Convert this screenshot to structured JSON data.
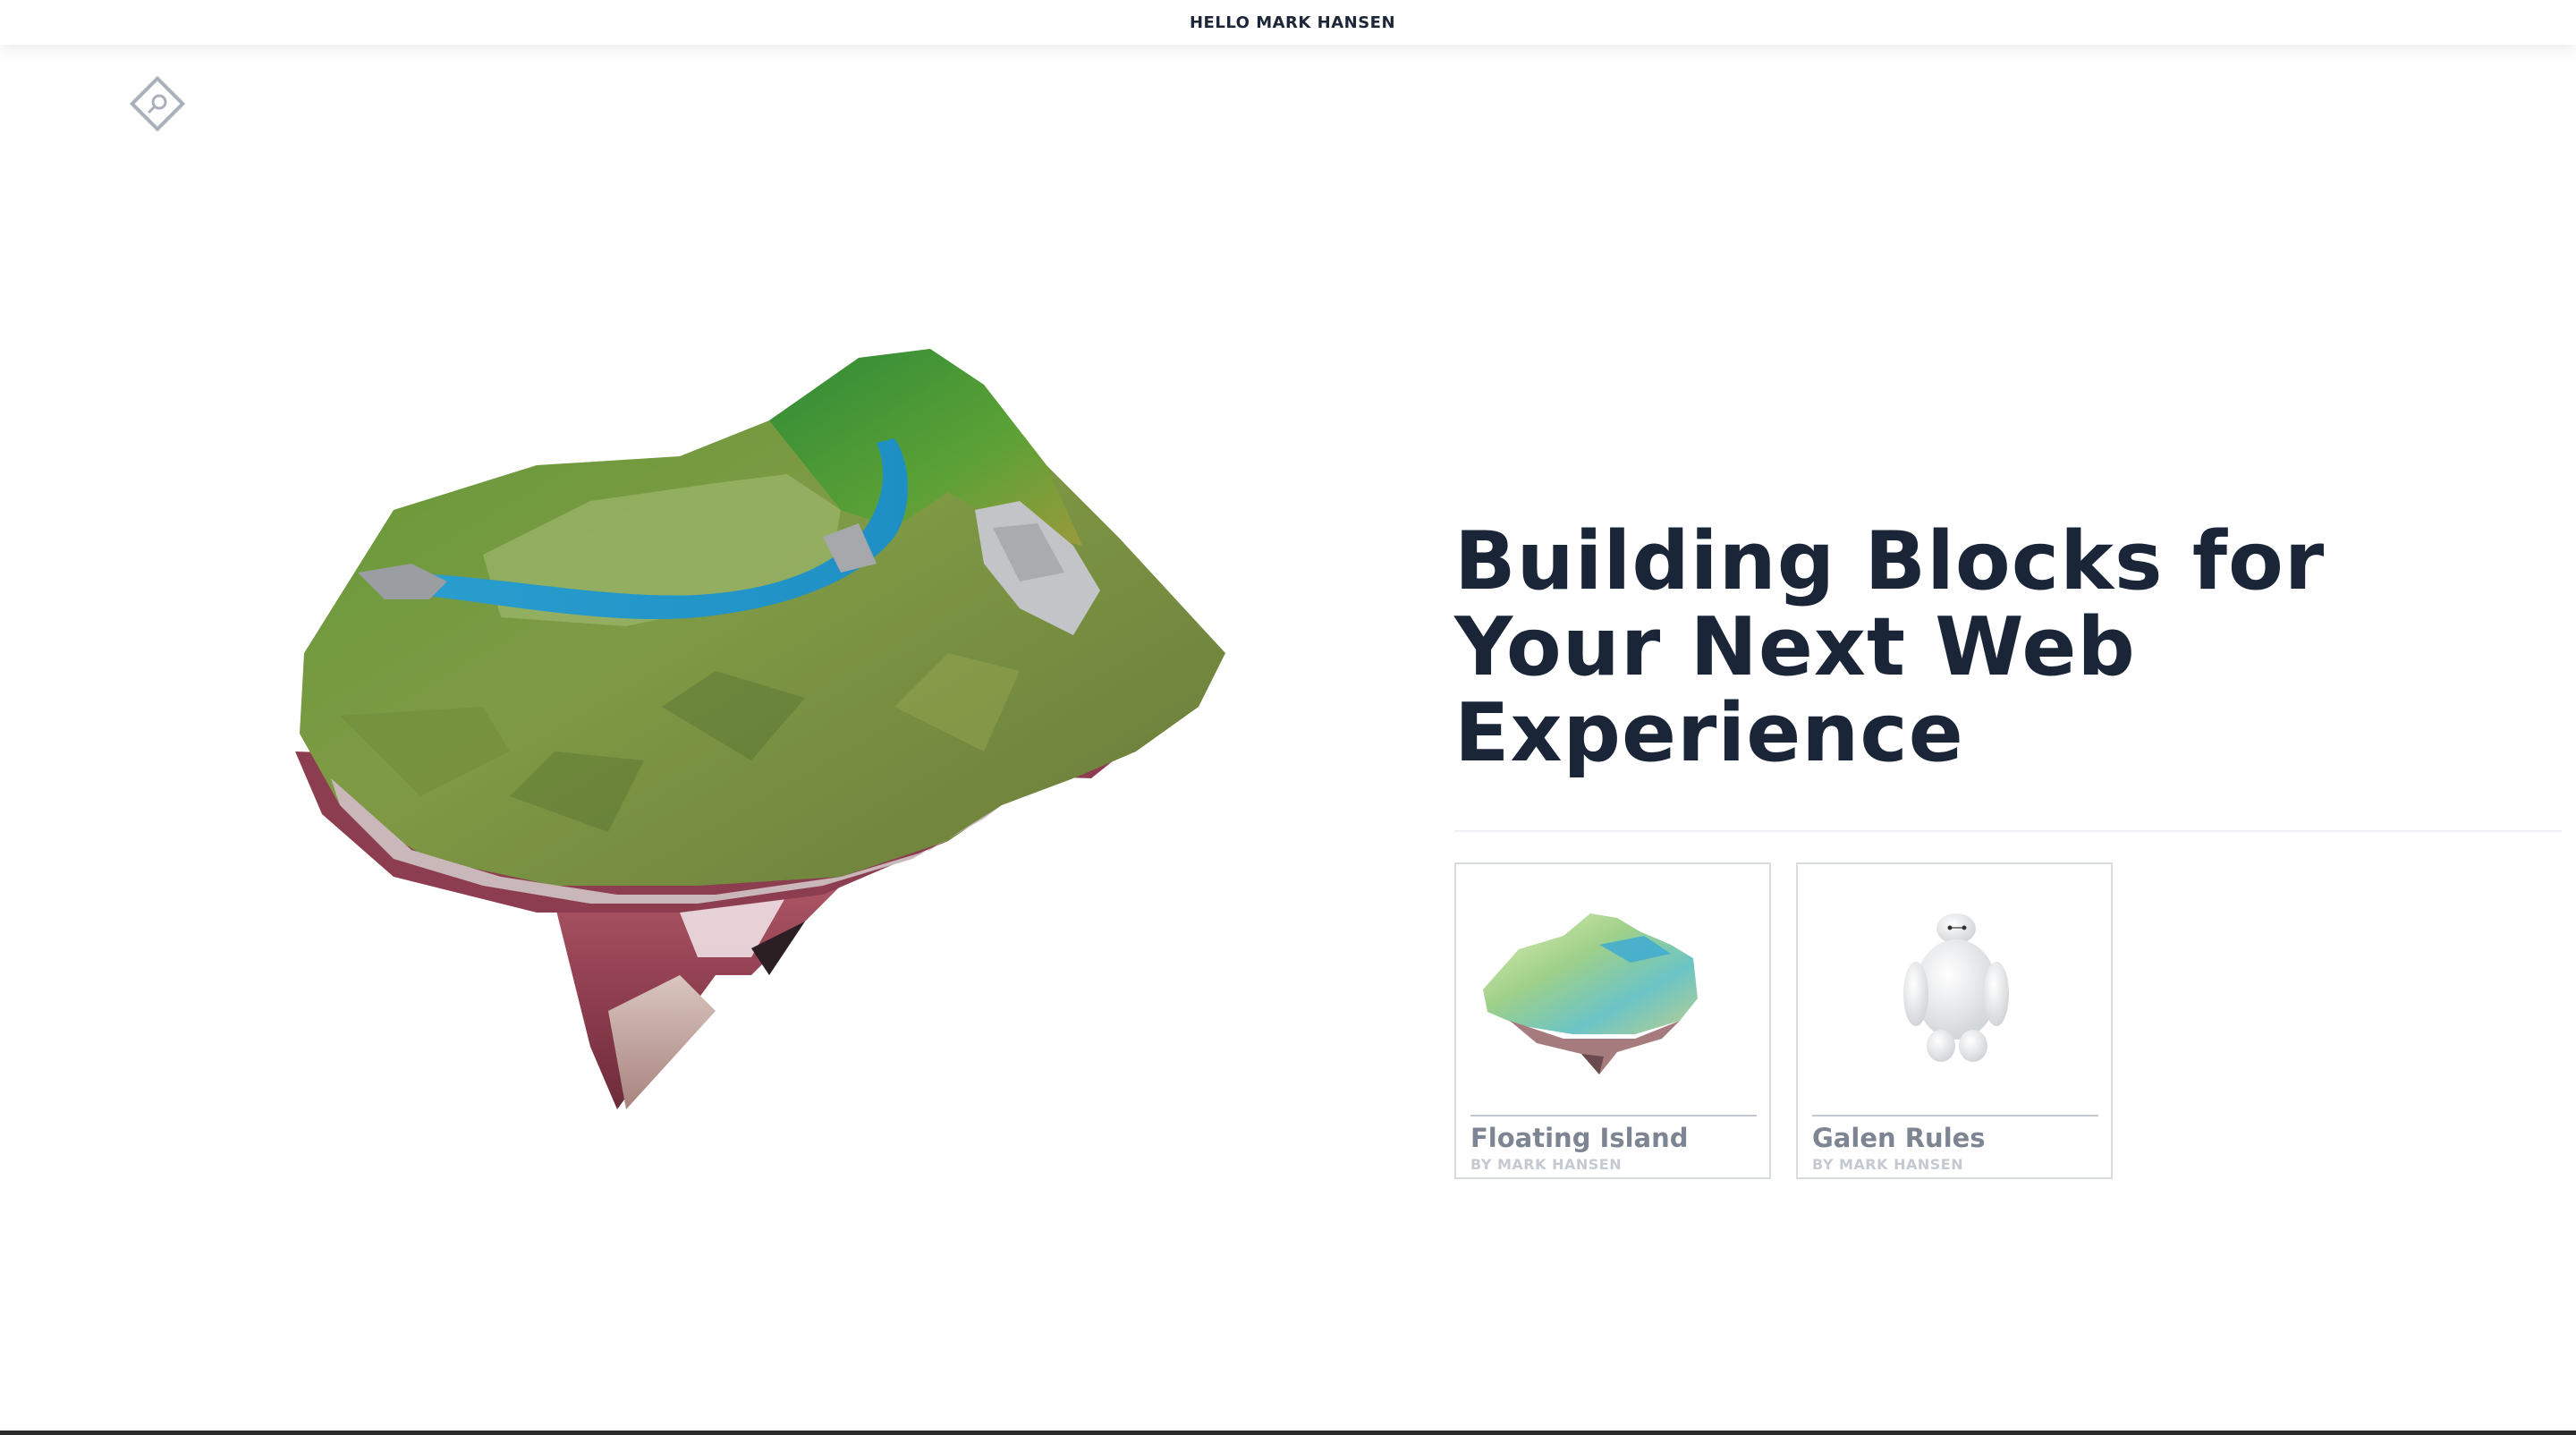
{
  "header": {
    "greeting": "HELLO MARK HANSEN"
  },
  "logo": {
    "icon": "search-diamond-icon"
  },
  "hero": {
    "headline": "Building Blocks for Your Next Web Experience",
    "model": "floating-island-model"
  },
  "cards": [
    {
      "title": "Floating Island",
      "author": "BY MARK HANSEN",
      "thumb": "floating-island-thumbnail"
    },
    {
      "title": "Galen Rules",
      "author": "BY MARK HANSEN",
      "thumb": "galen-robot-thumbnail"
    }
  ],
  "colors": {
    "heading": "#1b2538",
    "card_title": "#7e8592",
    "card_author": "#c5c9d0",
    "card_border": "#d8dbe0",
    "logo": "#a9b0bc"
  }
}
